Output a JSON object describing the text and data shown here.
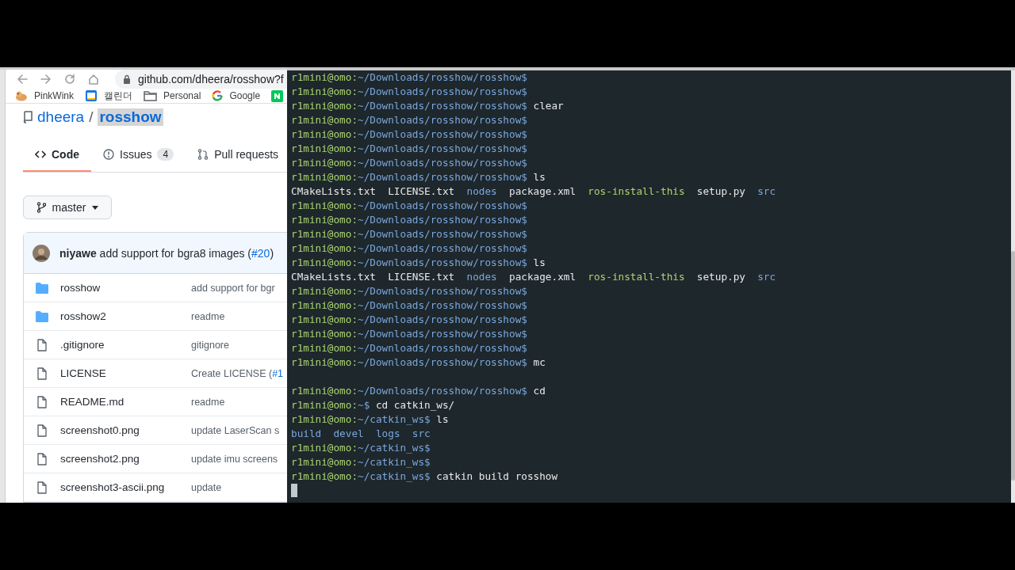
{
  "browser": {
    "address": "github.com/dheera/rosshow?f",
    "bookmarks": [
      {
        "label": "PinkWink"
      },
      {
        "label": "캘린더"
      },
      {
        "label": "Personal"
      },
      {
        "label": "Google"
      },
      {
        "kind": "icon"
      }
    ],
    "repo": {
      "owner": "dheera",
      "separator": "/",
      "name": "rosshow"
    },
    "tabs": [
      {
        "label": "Code",
        "selected": true
      },
      {
        "label": "Issues",
        "count": "4",
        "selected": false
      },
      {
        "label": "Pull requests",
        "selected": false
      }
    ],
    "branch": "master",
    "commit": {
      "author": "niyawe",
      "message": "add support for bgra8 images (",
      "link": "#20",
      "suffix": ")"
    },
    "files": [
      {
        "kind": "folder",
        "name": "rosshow",
        "message": "add support for bgr"
      },
      {
        "kind": "folder",
        "name": "rosshow2",
        "message": "readme"
      },
      {
        "kind": "file",
        "name": ".gitignore",
        "message": "gitignore"
      },
      {
        "kind": "file",
        "name": "LICENSE",
        "message": "Create LICENSE (",
        "link": "#1"
      },
      {
        "kind": "file",
        "name": "README.md",
        "message": "readme"
      },
      {
        "kind": "file",
        "name": "screenshot0.png",
        "message": "update LaserScan s"
      },
      {
        "kind": "file",
        "name": "screenshot2.png",
        "message": "update imu screens"
      },
      {
        "kind": "file",
        "name": "screenshot3-ascii.png",
        "message": "update"
      }
    ]
  },
  "terminal": {
    "lines": [
      {
        "kind": "prompt",
        "user_host": "r1mini@omo:",
        "path": "~/Downloads/rosshow/rosshow$"
      },
      {
        "kind": "prompt",
        "user_host": "r1mini@omo:",
        "path": "~/Downloads/rosshow/rosshow$"
      },
      {
        "kind": "prompt",
        "user_host": "r1mini@omo:",
        "path": "~/Downloads/rosshow/rosshow$",
        "command": "clear"
      },
      {
        "kind": "prompt",
        "user_host": "r1mini@omo:",
        "path": "~/Downloads/rosshow/rosshow$"
      },
      {
        "kind": "prompt",
        "user_host": "r1mini@omo:",
        "path": "~/Downloads/rosshow/rosshow$"
      },
      {
        "kind": "prompt",
        "user_host": "r1mini@omo:",
        "path": "~/Downloads/rosshow/rosshow$"
      },
      {
        "kind": "prompt",
        "user_host": "r1mini@omo:",
        "path": "~/Downloads/rosshow/rosshow$"
      },
      {
        "kind": "prompt",
        "user_host": "r1mini@omo:",
        "path": "~/Downloads/rosshow/rosshow$",
        "command": "ls"
      },
      {
        "kind": "output",
        "items": [
          {
            "text": "CMakeLists.txt",
            "kind": "file"
          },
          {
            "text": "LICENSE.txt",
            "kind": "file"
          },
          {
            "text": "nodes",
            "kind": "dir"
          },
          {
            "text": "package.xml",
            "kind": "file"
          },
          {
            "text": "ros-install-this",
            "kind": "exec"
          },
          {
            "text": "setup.py",
            "kind": "file"
          },
          {
            "text": "src",
            "kind": "dir"
          }
        ]
      },
      {
        "kind": "prompt",
        "user_host": "r1mini@omo:",
        "path": "~/Downloads/rosshow/rosshow$"
      },
      {
        "kind": "prompt",
        "user_host": "r1mini@omo:",
        "path": "~/Downloads/rosshow/rosshow$"
      },
      {
        "kind": "prompt",
        "user_host": "r1mini@omo:",
        "path": "~/Downloads/rosshow/rosshow$"
      },
      {
        "kind": "prompt",
        "user_host": "r1mini@omo:",
        "path": "~/Downloads/rosshow/rosshow$"
      },
      {
        "kind": "prompt",
        "user_host": "r1mini@omo:",
        "path": "~/Downloads/rosshow/rosshow$",
        "command": "ls"
      },
      {
        "kind": "output",
        "items": [
          {
            "text": "CMakeLists.txt",
            "kind": "file"
          },
          {
            "text": "LICENSE.txt",
            "kind": "file"
          },
          {
            "text": "nodes",
            "kind": "dir"
          },
          {
            "text": "package.xml",
            "kind": "file"
          },
          {
            "text": "ros-install-this",
            "kind": "exec"
          },
          {
            "text": "setup.py",
            "kind": "file"
          },
          {
            "text": "src",
            "kind": "dir"
          }
        ]
      },
      {
        "kind": "prompt",
        "user_host": "r1mini@omo:",
        "path": "~/Downloads/rosshow/rosshow$"
      },
      {
        "kind": "prompt",
        "user_host": "r1mini@omo:",
        "path": "~/Downloads/rosshow/rosshow$"
      },
      {
        "kind": "prompt",
        "user_host": "r1mini@omo:",
        "path": "~/Downloads/rosshow/rosshow$"
      },
      {
        "kind": "prompt",
        "user_host": "r1mini@omo:",
        "path": "~/Downloads/rosshow/rosshow$"
      },
      {
        "kind": "prompt",
        "user_host": "r1mini@omo:",
        "path": "~/Downloads/rosshow/rosshow$"
      },
      {
        "kind": "prompt",
        "user_host": "r1mini@omo:",
        "path": "~/Downloads/rosshow/rosshow$",
        "command": "mc"
      },
      {
        "kind": "blank"
      },
      {
        "kind": "prompt",
        "user_host": "r1mini@omo:",
        "path": "~/Downloads/rosshow/rosshow$",
        "command": "cd"
      },
      {
        "kind": "prompt",
        "user_host": "r1mini@omo:",
        "path": "~$",
        "command": "cd catkin_ws/"
      },
      {
        "kind": "prompt",
        "user_host": "r1mini@omo:",
        "path": "~/catkin_ws$",
        "command": "ls"
      },
      {
        "kind": "output",
        "items": [
          {
            "text": "build",
            "kind": "dir"
          },
          {
            "text": "devel",
            "kind": "dir"
          },
          {
            "text": "logs",
            "kind": "dir"
          },
          {
            "text": "src",
            "kind": "dir"
          }
        ]
      },
      {
        "kind": "prompt",
        "user_host": "r1mini@omo:",
        "path": "~/catkin_ws$"
      },
      {
        "kind": "prompt",
        "user_host": "r1mini@omo:",
        "path": "~/catkin_ws$"
      },
      {
        "kind": "prompt",
        "user_host": "r1mini@omo:",
        "path": "~/catkin_ws$",
        "command": "catkin build rosshow"
      },
      {
        "kind": "cursor"
      }
    ]
  }
}
